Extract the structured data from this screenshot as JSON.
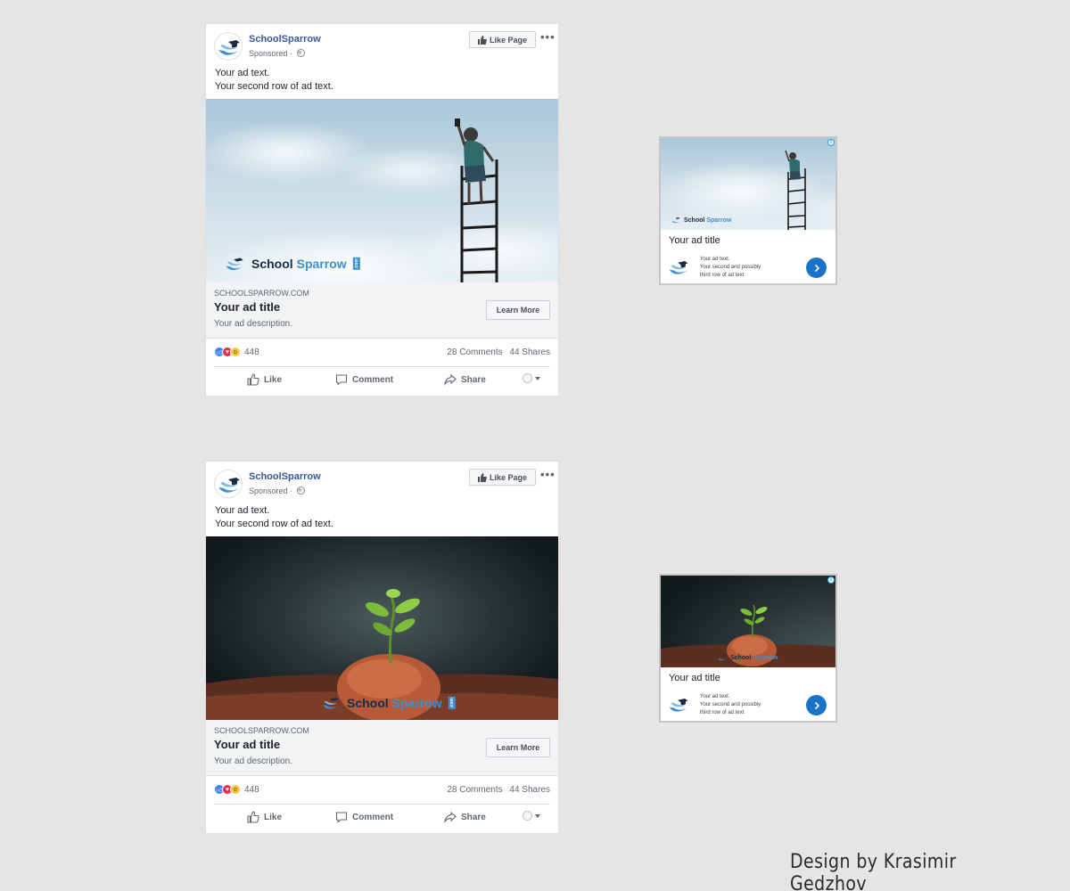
{
  "ads": [
    {
      "page_name": "SchoolSparrow",
      "sponsored": "Sponsored ·",
      "like_page_label": "Like Page",
      "ad_text_line1": "Your ad text.",
      "ad_text_line2": "Your second row of ad text.",
      "image_icon": "boy-on-ladder-sky-photo",
      "image_logo_part1": "School",
      "image_logo_part2": "Sparrow",
      "image_logo_com": ".com",
      "domain": "SCHOOLSPARROW.COM",
      "title": "Your ad title",
      "description": "Your ad description.",
      "cta": "Learn More",
      "reaction_count": "448",
      "comments": "28 Comments",
      "shares": "44 Shares",
      "actions": {
        "like": "Like",
        "comment": "Comment",
        "share": "Share"
      }
    },
    {
      "page_name": "SchoolSparrow",
      "sponsored": "Sponsored ·",
      "like_page_label": "Like Page",
      "ad_text_line1": "Your ad text.",
      "ad_text_line2": "Your second row of ad text.",
      "image_icon": "seedling-on-rock-photo",
      "image_logo_part1": "School",
      "image_logo_part2": "Sparrow",
      "image_logo_com": ".com",
      "domain": "SCHOOLSPARROW.COM",
      "title": "Your ad title",
      "description": "Your ad description.",
      "cta": "Learn More",
      "reaction_count": "448",
      "comments": "28 Comments",
      "shares": "44 Shares",
      "actions": {
        "like": "Like",
        "comment": "Comment",
        "share": "Share"
      }
    }
  ],
  "display_ads": [
    {
      "title": "Your ad title",
      "text_line1": "Your ad text.",
      "text_line2": "Your second and possibly",
      "text_line3": "third row of ad text",
      "info_icon": "i",
      "logo_part1": "School",
      "logo_part2": "Sparrow",
      "image_icon": "boy-on-ladder-sky-photo"
    },
    {
      "title": "Your ad title",
      "text_line1": "Your ad text.",
      "text_line2": "Your second and possibly",
      "text_line3": "third row of ad text",
      "info_icon": "i",
      "logo_part1": "School",
      "logo_part2": "Sparrow",
      "image_icon": "seedling-on-rock-photo"
    }
  ],
  "credit": "Design by Krasimir Gedzhov",
  "colors": {
    "background": "#e5e5e5",
    "page_name": "#365899",
    "link_box": "#f2f3f5",
    "brand_dark": "#1b2a45",
    "brand_blue": "#3d8fd0",
    "cta_circle": "#1a73c8"
  }
}
